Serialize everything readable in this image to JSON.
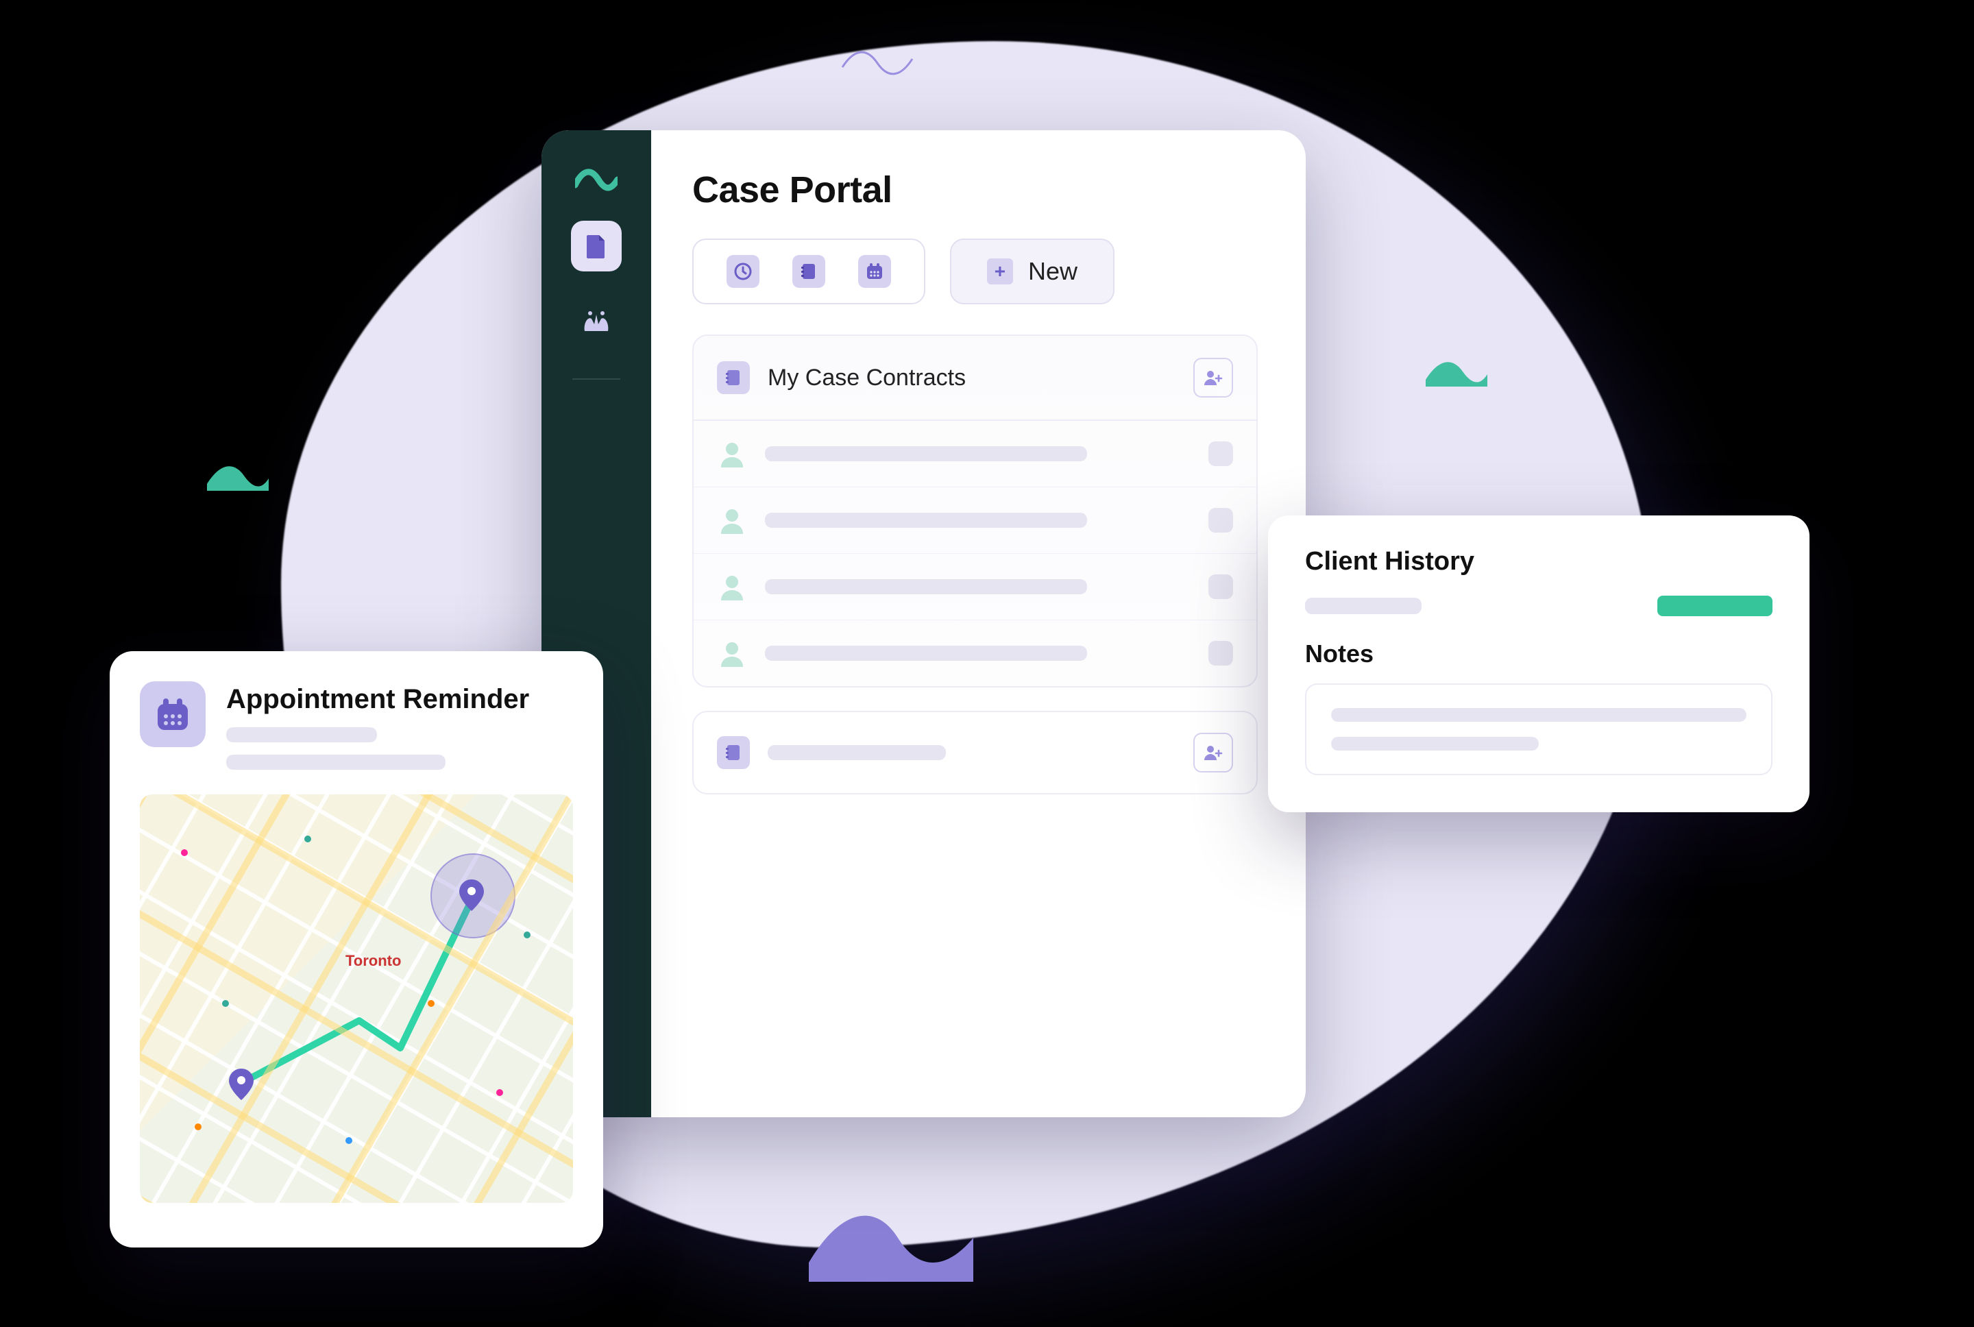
{
  "portal": {
    "title": "Case Portal",
    "new_button": "New",
    "contracts_title": "My Case Contracts"
  },
  "appointment": {
    "title": "Appointment Reminder",
    "map_city": "Toronto"
  },
  "client": {
    "history_title": "Client History",
    "notes_title": "Notes"
  },
  "colors": {
    "teal": "#3FBFA0",
    "purple": "#8A7FD6",
    "lavender": "#D6D2F0",
    "sidebar": "#15302E"
  }
}
